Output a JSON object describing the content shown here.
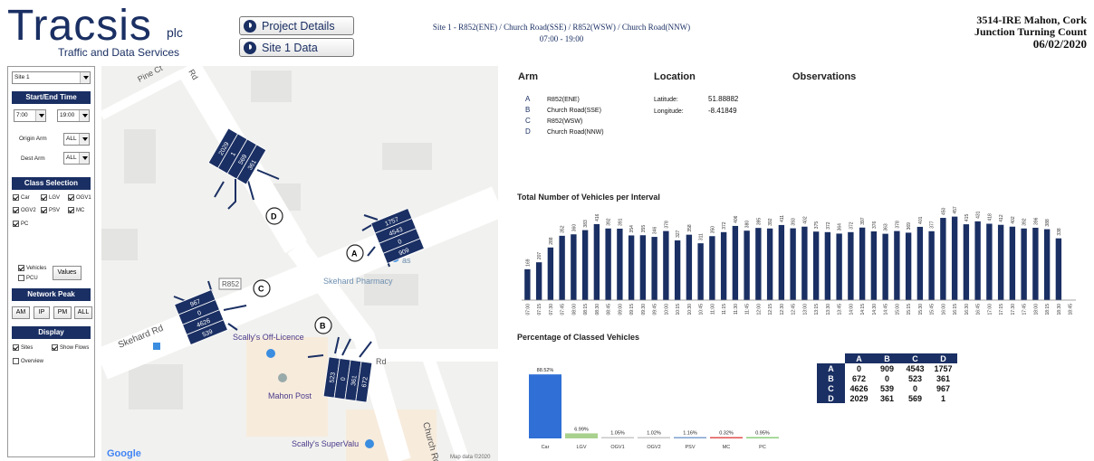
{
  "logo": {
    "name": "Tracsis",
    "plc": "plc",
    "tagline": "Traffic and Data Services"
  },
  "buttons": {
    "project_details": "Project Details",
    "site_data": "Site 1 Data"
  },
  "site_header": {
    "line1": "Site 1 - R852(ENE) / Church Road(SSE) / R852(WSW) / Church Road(NNW)",
    "line2": "07:00 - 19:00"
  },
  "report": {
    "title": "3514-IRE Mahon, Cork",
    "subtitle": "Junction Turning Count",
    "date": "06/02/2020"
  },
  "sidebar": {
    "site_select": "Site 1",
    "start_end_header": "Start/End Time",
    "start_time": "7:00",
    "end_time": "19:00",
    "origin_label": "Origin Arm",
    "origin_value": "ALL",
    "dest_label": "Dest Arm",
    "dest_value": "ALL",
    "class_header": "Class Selection",
    "classes": [
      "Car",
      "LGV",
      "OGV1",
      "OGV2",
      "PSV",
      "MC",
      "PC"
    ],
    "vehicles_label": "Vehicles",
    "pcu_label": "PCU",
    "values_button": "Values",
    "network_header": "Network Peak",
    "peaks": [
      "AM",
      "IP",
      "PM",
      "ALL"
    ],
    "display_header": "Display",
    "sites_label": "Sites",
    "show_flows_label": "Show Flows",
    "overview_label": "Overview"
  },
  "map": {
    "streets": [
      "Pine Ct",
      "Skehard Rd",
      "Church Rd",
      "R852",
      "Rd",
      "Rd"
    ],
    "places": [
      "Skehard Pharmacy",
      "Scally's Off-Licence",
      "Mahon Post",
      "Scally's SuperValu",
      "as"
    ],
    "google": "Google",
    "map_data": "Map data ©2020",
    "arm_markers": [
      "A",
      "B",
      "C",
      "D"
    ],
    "flow_boxes": {
      "D": [
        "2029",
        "1",
        "569",
        "361"
      ],
      "A": [
        "1757",
        "4543",
        "0",
        "909"
      ],
      "C": [
        "967",
        "0",
        "4626",
        "539"
      ],
      "B": [
        "523",
        "0",
        "361",
        "672"
      ]
    }
  },
  "info": {
    "arm_header": "Arm",
    "location_header": "Location",
    "observations_header": "Observations",
    "arms": [
      {
        "letter": "A",
        "name": "R852(ENE)"
      },
      {
        "letter": "B",
        "name": "Church Road(SSE)"
      },
      {
        "letter": "C",
        "name": "R852(WSW)"
      },
      {
        "letter": "D",
        "name": "Church Road(NNW)"
      }
    ],
    "latitude_label": "Latitude:",
    "latitude": "51.88882",
    "longitude_label": "Longitude:",
    "longitude": "-8.41849"
  },
  "chart_data": [
    {
      "type": "bar",
      "title": "Total Number of Vehicles per Interval",
      "categories": [
        "07:00",
        "07:15",
        "07:30",
        "07:45",
        "08:00",
        "08:15",
        "08:30",
        "08:45",
        "09:00",
        "09:15",
        "09:30",
        "09:45",
        "10:00",
        "10:15",
        "10:30",
        "10:45",
        "11:00",
        "11:15",
        "11:30",
        "11:45",
        "12:00",
        "12:15",
        "12:30",
        "12:45",
        "13:00",
        "13:15",
        "13:30",
        "13:45",
        "14:00",
        "14:15",
        "14:30",
        "14:45",
        "15:00",
        "15:15",
        "15:30",
        "15:45",
        "16:00",
        "16:15",
        "16:30",
        "16:45",
        "17:00",
        "17:15",
        "17:30",
        "17:45",
        "18:00",
        "18:15",
        "18:30",
        "18:45"
      ],
      "values": [
        169,
        207,
        288,
        352,
        360,
        383,
        416,
        392,
        391,
        354,
        355,
        346,
        378,
        327,
        358,
        311,
        350,
        372,
        406,
        380,
        395,
        392,
        411,
        393,
        402,
        375,
        372,
        364,
        372,
        397,
        376,
        363,
        378,
        369,
        401,
        377,
        450,
        457,
        415,
        431,
        418,
        412,
        402,
        392,
        396,
        388,
        338,
        0
      ],
      "ylim": [
        0,
        470
      ],
      "color": "#1a2f63"
    },
    {
      "type": "bar",
      "title": "Percentage of Classed Vehicles",
      "categories": [
        "Car",
        "LGV",
        "OGV1",
        "OGV2",
        "PSV",
        "MC",
        "PC"
      ],
      "values": [
        88.52,
        6.99,
        1.05,
        1.02,
        1.16,
        0.32,
        0.95
      ],
      "labels": [
        "88.52%",
        "6.99%",
        "1.05%",
        "1.02%",
        "1.16%",
        "0.32%",
        "0.95%"
      ],
      "colors": [
        "#2f6fd6",
        "#a9d18e",
        "#c8c8c8",
        "#c8c8c8",
        "#7fa0d0",
        "#e05050",
        "#8ccf7e"
      ],
      "ylim": [
        0,
        100
      ]
    }
  ],
  "matrix": {
    "headers": [
      "A",
      "B",
      "C",
      "D"
    ],
    "rows": [
      {
        "label": "A",
        "values": [
          "0",
          "909",
          "4543",
          "1757"
        ]
      },
      {
        "label": "B",
        "values": [
          "672",
          "0",
          "523",
          "361"
        ]
      },
      {
        "label": "C",
        "values": [
          "4626",
          "539",
          "0",
          "967"
        ]
      },
      {
        "label": "D",
        "values": [
          "2029",
          "361",
          "569",
          "1"
        ]
      }
    ]
  }
}
